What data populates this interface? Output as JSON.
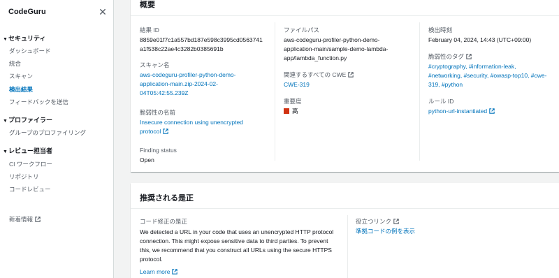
{
  "sidebar": {
    "title": "CodeGuru",
    "close_glyph": "✕",
    "sections": [
      {
        "label": "セキュリティ",
        "items": [
          "ダッシュボード",
          "統合",
          "スキャン",
          "検出結果",
          "フィードバックを送信"
        ]
      },
      {
        "label": "プロファイラー",
        "items": [
          "グループのプロファイリング"
        ]
      },
      {
        "label": "レビュー担当者",
        "items": [
          "CI ワークフロー",
          "リポジトリ",
          "コードレビュー"
        ]
      }
    ],
    "active_item": "検出結果",
    "whats_new": "新着情報"
  },
  "overview": {
    "title": "概要",
    "finding_id_label": "結果 ID",
    "finding_id_line1": "8859e01f7c1a557bd187e598c3995cd0563741",
    "finding_id_line2": "a1f538c22ae4c3282b0385691b",
    "scan_name_label": "スキャン名",
    "scan_name_line1": "aws-codeguru-profiler-python-demo-",
    "scan_name_line2": "application-main.zip-2024-02-",
    "scan_name_line3": "04T05:42:55.239Z",
    "vuln_name_label": "脆弱性の名前",
    "vuln_name_line1": "Insecure connection using unencrypted",
    "vuln_name_line2": "protocol",
    "finding_status_label": "Finding status",
    "finding_status_value": "Open",
    "file_path_label": "ファイルパス",
    "file_path_line1": "aws-codeguru-profiler-python-demo-",
    "file_path_line2": "application-main/sample-demo-lambda-",
    "file_path_line3": "app/lambda_function.py",
    "cwe_label": "関連するすべての CWE",
    "cwe_value": "CWE-319",
    "severity_label": "重要度",
    "severity_value": "高",
    "detected_label": "検出時刻",
    "detected_value": "February 04, 2024, 14:43 (UTC+09:00)",
    "tags_label": "脆弱性のタグ",
    "tags_line1": "#cryptography, #information-leak,",
    "tags_line2": "#networking, #security, #owasp-top10, #cwe-",
    "tags_line3": "319, #python",
    "rule_label": "ルール ID",
    "rule_value": "python-url-instantiated"
  },
  "remediation": {
    "title": "推奨される是正",
    "code_fix_label": "コード修正の是正",
    "desc_line1": "We detected a URL in your code that uses an unencrypted HTTP protocol",
    "desc_line2": "connection. This might expose sensitive data to third parties. To prevent",
    "desc_line3": "this, we recommend that you construct all URLs using the secure HTTPS",
    "desc_line4": "protocol.",
    "learn_more": "Learn more",
    "links_label": "役立つリンク",
    "links_value": "準拠コードの例を表示"
  },
  "colors": {
    "link": "#0073bb",
    "severity_high": "#d13212"
  }
}
